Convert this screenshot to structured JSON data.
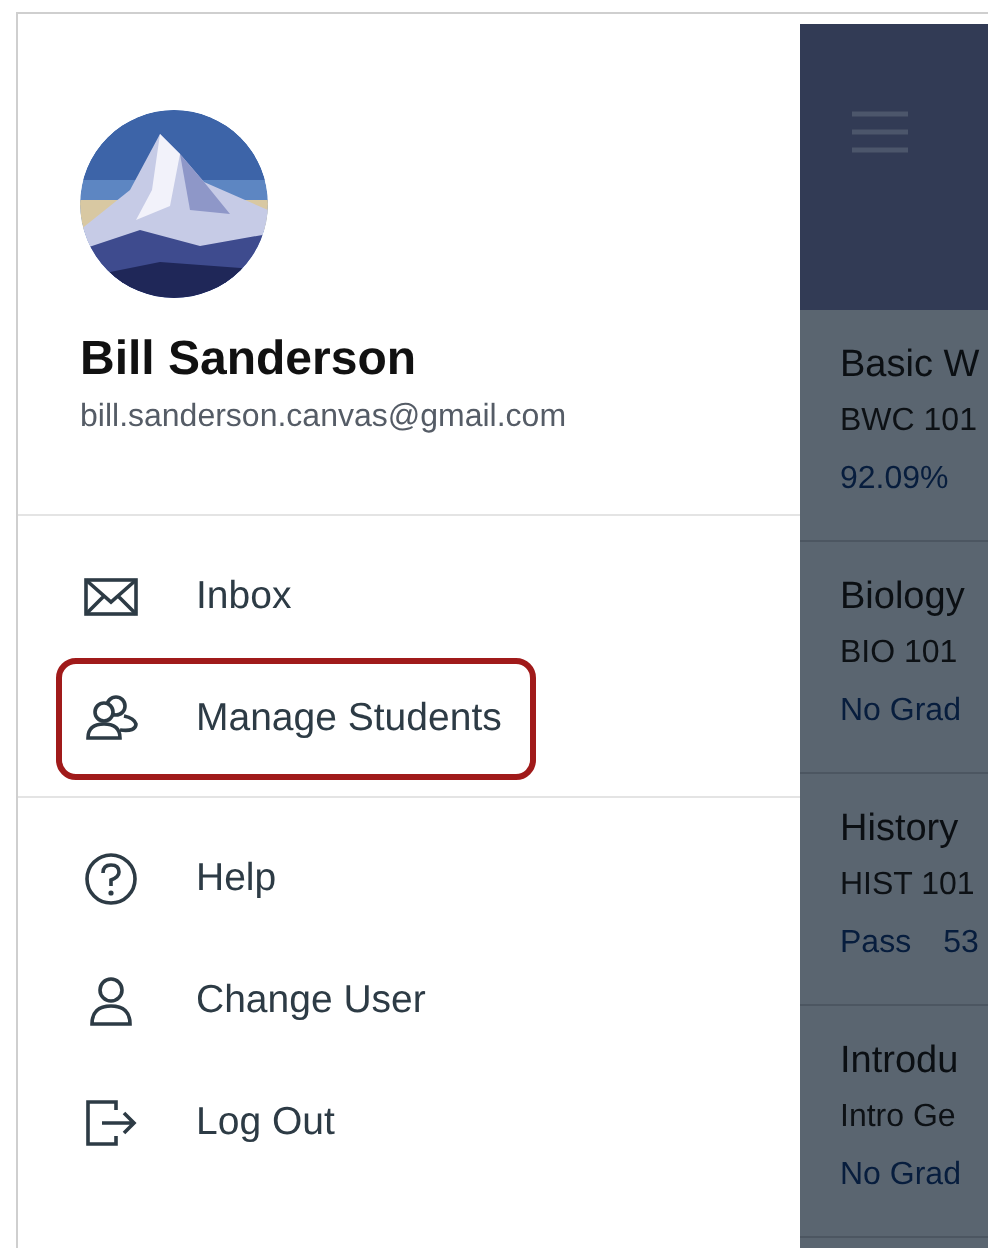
{
  "profile": {
    "name": "Bill Sanderson",
    "email": "bill.sanderson.canvas@gmail.com"
  },
  "menu_sections": [
    {
      "items": [
        {
          "kind": "mail",
          "label": "Inbox",
          "highlighted": false
        },
        {
          "kind": "people",
          "label": "Manage Students",
          "highlighted": true
        }
      ]
    },
    {
      "items": [
        {
          "kind": "help",
          "label": "Help",
          "highlighted": false
        },
        {
          "kind": "user",
          "label": "Change User",
          "highlighted": false
        },
        {
          "kind": "logout",
          "label": "Log Out",
          "highlighted": false
        }
      ]
    }
  ],
  "background_courses": [
    {
      "title": "Basic W",
      "code": "BWC 101",
      "grades": [
        "92.09%"
      ]
    },
    {
      "title": "Biology",
      "code": "BIO 101",
      "grades": [
        "No Grad"
      ]
    },
    {
      "title": "History",
      "code": "HIST 101",
      "grades": [
        "Pass",
        "53"
      ]
    },
    {
      "title": "Introdu",
      "code": "Intro Ge",
      "grades": [
        "No Grad"
      ]
    }
  ]
}
